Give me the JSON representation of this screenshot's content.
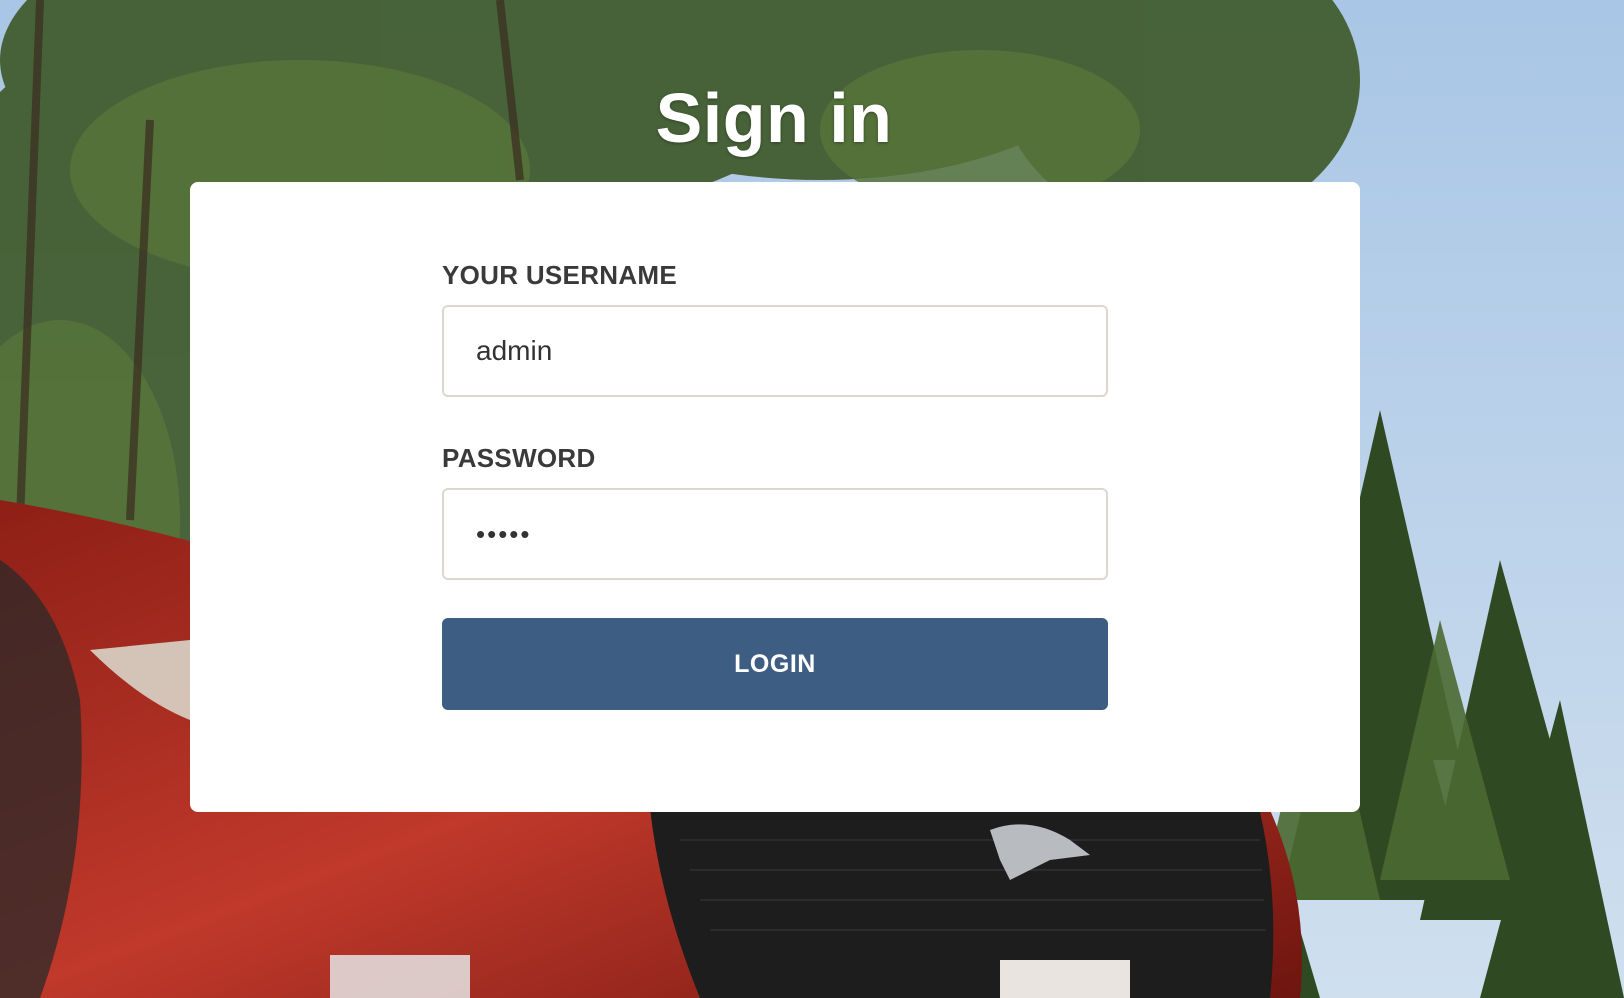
{
  "page": {
    "title": "Sign in"
  },
  "form": {
    "username": {
      "label": "YOUR USERNAME",
      "value": "admin"
    },
    "password": {
      "label": "PASSWORD",
      "value": "•••••"
    },
    "submit_label": "LOGIN"
  },
  "colors": {
    "button": "#3d5e82",
    "card": "#ffffff",
    "label_text": "#3a3a3a"
  }
}
